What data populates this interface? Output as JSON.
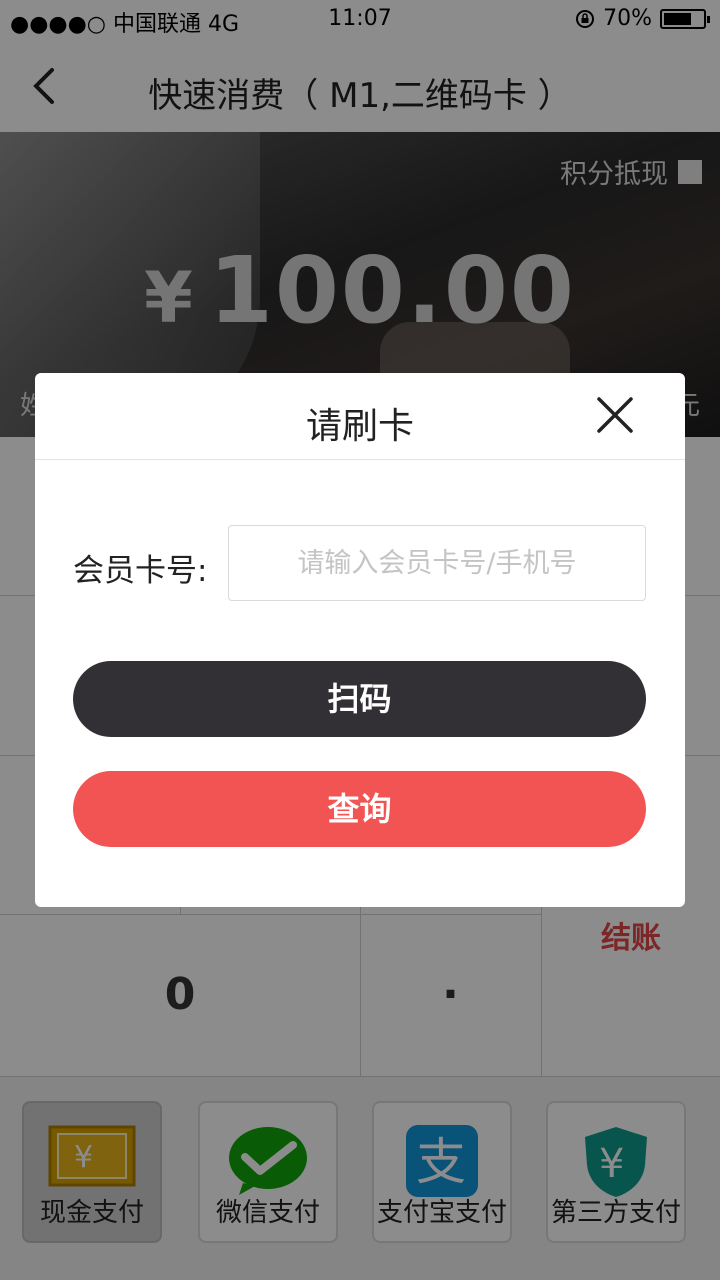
{
  "status_bar": {
    "carrier": "●●●●○ 中国联通  4G",
    "time": "11:07",
    "battery": "70%",
    "battery_level": 0.7
  },
  "nav": {
    "title": "快速消费（ M1,二维码卡 ）",
    "back_icon": "chevron-left-icon"
  },
  "hero": {
    "points_label": "积分抵现",
    "currency": "¥",
    "amount": "100.00",
    "left_partial": "姓",
    "right_partial": "元"
  },
  "keypad": {
    "zero": "0",
    "dot": "·",
    "checkout": "结账"
  },
  "pay_methods": [
    {
      "label": "现金支付",
      "icon": "cash-icon"
    },
    {
      "label": "微信支付",
      "icon": "wechat-icon"
    },
    {
      "label": "支付宝支付",
      "icon": "alipay-icon"
    },
    {
      "label": "第三方支付",
      "icon": "shield-yen-icon"
    }
  ],
  "modal": {
    "title": "请刷卡",
    "field_label": "会员卡号:",
    "placeholder": "请输入会员卡号/手机号",
    "scan_button": "扫码",
    "query_button": "查询"
  },
  "colors": {
    "scan": "#323035",
    "query": "#f25454",
    "checkout": "#e04848"
  }
}
